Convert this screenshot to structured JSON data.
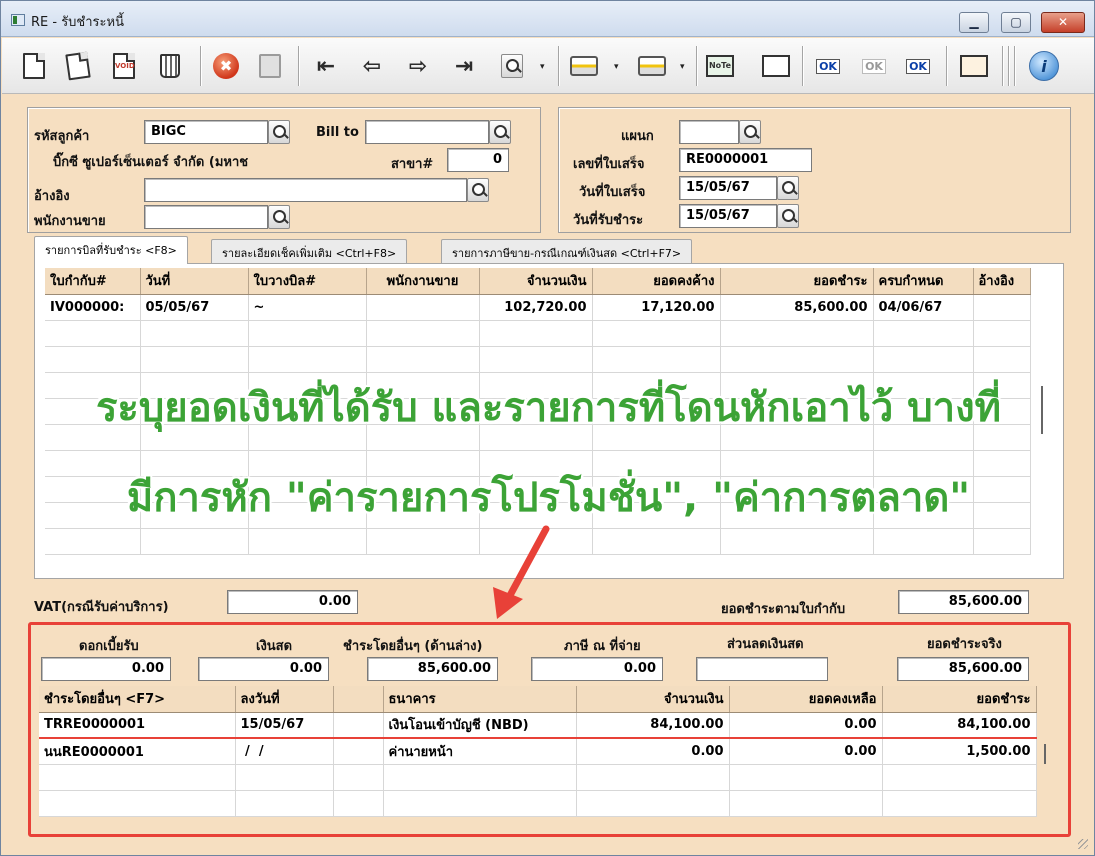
{
  "window": {
    "title": "RE - รับชำระหนี้",
    "btn_min": "▁",
    "btn_max": "▢",
    "btn_close": "✕"
  },
  "toolbar": {
    "icons": [
      "new-document-icon",
      "edit-icon",
      "void-icon",
      "trash-icon",
      "cancel-icon",
      "save-icon",
      "first-record-icon",
      "previous-record-icon",
      "next-record-icon",
      "last-record-icon",
      "search-record-icon",
      "print-icon",
      "print-vat-icon",
      "note-icon",
      "report-icon",
      "approve-ok-icon",
      "approve-ok-disabled-icon",
      "ok-document-icon",
      "calculator-icon",
      "info-icon"
    ],
    "arrow_first": "⇤",
    "arrow_prev": "⇦",
    "arrow_next": "⇨",
    "arrow_last": "⇥",
    "stop_glyph": "✖",
    "void_label": "VOID",
    "note_label": "NoTe",
    "ok_label": "OK",
    "info_glyph": "i",
    "dropdown_glyph": "▾"
  },
  "header_left": {
    "customer_code_label": "รหัสลูกค้า",
    "customer_code": "BIGC",
    "bill_to_label": "Bill to",
    "bill_to": "",
    "customer_name": "บิ๊กซี ซูเปอร์เซ็นเตอร์ จำกัด (มหาช",
    "branch_label": "สาขา#",
    "branch": "0",
    "reference_label": "อ้างอิง",
    "reference": "",
    "salesperson_label": "พนักงานขาย",
    "salesperson": ""
  },
  "header_right": {
    "department_label": "แผนก",
    "department": "",
    "receipt_no_label": "เลขที่ใบเสร็จ",
    "receipt_no": "RE0000001",
    "receipt_date_label": "วันที่ใบเสร็จ",
    "receipt_date": "15/05/67",
    "payment_date_label": "วันที่รับชำระ",
    "payment_date": "15/05/67"
  },
  "tabs": [
    {
      "label": "รายการบิลที่รับชำระ <F8>"
    },
    {
      "label": "รายละเอียดเช็คเพิ่มเติม <Ctrl+F8>"
    },
    {
      "label": "รายการภาษีขาย-กรณีเกณฑ์เงินสด <Ctrl+F7>"
    }
  ],
  "invoice_grid": {
    "columns": [
      "ใบกำกับ#",
      "วันที่",
      "ใบวางบิล#",
      "พนักงานขาย",
      "จำนวนเงิน",
      "ยอดคงค้าง",
      "ยอดชำระ",
      "ครบกำหนด",
      "อ้างอิง"
    ],
    "rows": [
      [
        "IV000000:",
        "05/05/67",
        "~",
        "",
        "102,720.00",
        "17,120.00",
        "85,600.00",
        "04/06/67",
        ""
      ]
    ]
  },
  "annotation": {
    "line1": "ระบุยอดเงินที่ได้รับ และรายการที่โดนหักเอาไว้ บางที่",
    "line2": "มีการหัก \"ค่ารายการโปรโมชั่น\", \"ค่าการตลาด\"",
    "highlight_color": "#e84138",
    "text_color": "#3ca336"
  },
  "totals": {
    "vat_label": "VAT(กรณีรับค่าบริการ)",
    "vat_value": "0.00",
    "due_by_invoice_label": "ยอดชำระตามใบกำกับ",
    "due_by_invoice_value": "85,600.00"
  },
  "payment_summary": {
    "interest_label": "ดอกเบี้ยรับ",
    "interest": "0.00",
    "cash_label": "เงินสด",
    "cash": "0.00",
    "other_label": "ชำระโดยอื่นๆ (ด้านล่าง)",
    "other": "85,600.00",
    "wht_label": "ภาษี ณ ที่จ่าย",
    "wht": "0.00",
    "discount_label": "ส่วนลดเงินสด",
    "discount": "",
    "actual_label": "ยอดชำระจริง",
    "actual": "85,600.00"
  },
  "other_payment_grid": {
    "columns": [
      "ชำระโดยอื่นๆ <F7>",
      "ลงวันที่",
      "",
      "ธนาคาร",
      "จำนวนเงิน",
      "ยอดคงเหลือ",
      "ยอดชำระ"
    ],
    "rows": [
      [
        "TRRE0000001",
        "15/05/67",
        "",
        "เงินโอนเข้าบัญชี (NBD)",
        "84,100.00",
        "0.00",
        "84,100.00"
      ],
      [
        "นนRE0000001",
        " /  /",
        "",
        "ค่านายหน้า",
        "0.00",
        "0.00",
        "1,500.00"
      ]
    ]
  }
}
